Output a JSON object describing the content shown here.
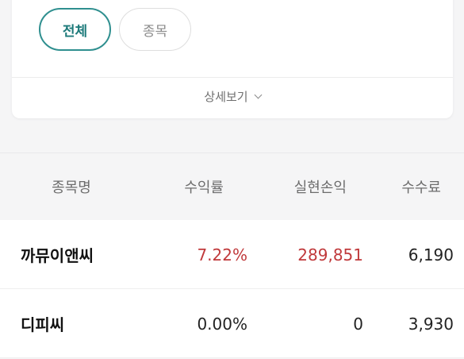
{
  "filter": {
    "tabs": [
      {
        "label": "전체",
        "selected": true
      },
      {
        "label": "종목",
        "selected": false
      }
    ],
    "more_label": "상세보기"
  },
  "table": {
    "headers": {
      "name": "종목명",
      "rate": "수익률",
      "profit_loss": "실현손익",
      "fee": "수수료"
    },
    "rows": [
      {
        "name": "까뮤이앤씨",
        "rate": "7.22%",
        "profit_loss": "289,851",
        "fee": "6,190",
        "tone": "positive"
      },
      {
        "name": "디피씨",
        "rate": "0.00%",
        "profit_loss": "0",
        "fee": "3,930",
        "tone": "neutral"
      }
    ]
  },
  "colors": {
    "accent": "#2f8f8f",
    "positive": "#c0393b",
    "neutral_text": "#222222"
  }
}
